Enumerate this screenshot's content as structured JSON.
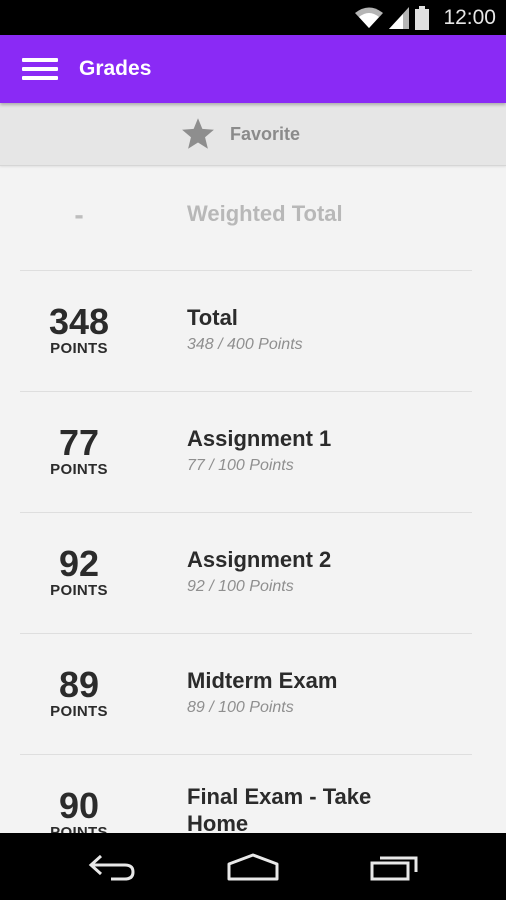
{
  "status_bar": {
    "time": "12:00",
    "icons": [
      "wifi-icon",
      "signal-icon",
      "battery-icon"
    ]
  },
  "app_bar": {
    "title": "Grades",
    "color": "#8a2af5",
    "menu_icon": "menu-icon"
  },
  "favorite_bar": {
    "label": "Favorite",
    "icon": "star-icon"
  },
  "grades": {
    "weighted_total": {
      "value": "-",
      "label": "Weighted Total"
    },
    "items": [
      {
        "score": "348",
        "unit": "POINTS",
        "title": "Total",
        "detail": "348 / 400 Points"
      },
      {
        "score": "77",
        "unit": "POINTS",
        "title": "Assignment 1",
        "detail": "77 / 100 Points"
      },
      {
        "score": "92",
        "unit": "POINTS",
        "title": "Assignment 2",
        "detail": "92 / 100 Points"
      },
      {
        "score": "89",
        "unit": "POINTS",
        "title": "Midterm Exam",
        "detail": "89 / 100 Points"
      },
      {
        "score": "90",
        "unit": "POINTS",
        "title": "Final Exam - Take Home",
        "detail": ""
      }
    ]
  },
  "nav_bar": {
    "buttons": [
      "back-icon",
      "home-icon",
      "recents-icon"
    ]
  }
}
